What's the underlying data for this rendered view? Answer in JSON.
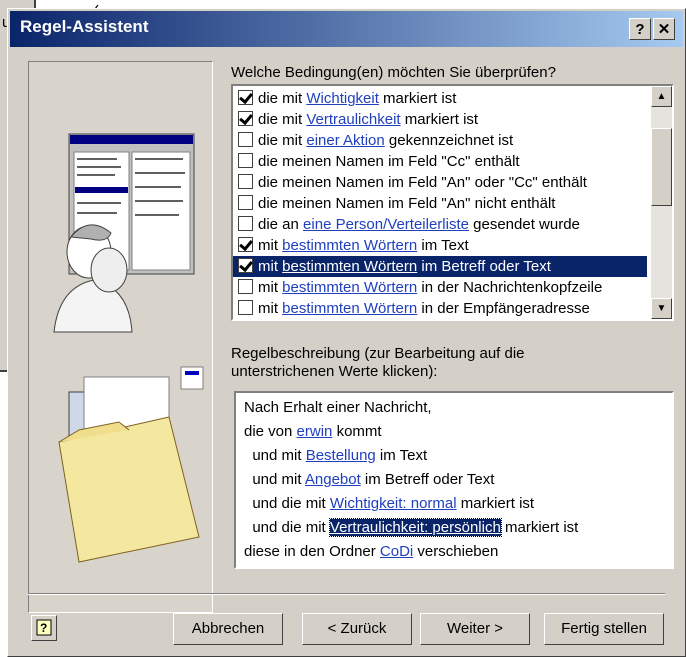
{
  "background_window": {
    "label": "u"
  },
  "dialog": {
    "title": "Regel-Assistent",
    "help_button": "?",
    "close_button": "✕"
  },
  "conditions": {
    "heading": "Welche Bedingung(en) möchten Sie überprüfen?",
    "items": [
      {
        "checked": true,
        "selected": false,
        "before": "die mit ",
        "link": "Wichtigkeit",
        "after": " markiert ist"
      },
      {
        "checked": true,
        "selected": false,
        "before": "die mit ",
        "link": "Vertraulichkeit",
        "after": " markiert ist"
      },
      {
        "checked": false,
        "selected": false,
        "before": "die mit ",
        "link": "einer Aktion",
        "after": " gekennzeichnet ist"
      },
      {
        "checked": false,
        "selected": false,
        "before": "die meinen Namen im Feld \"Cc\" enthält",
        "link": "",
        "after": ""
      },
      {
        "checked": false,
        "selected": false,
        "before": "die meinen Namen im Feld \"An\" oder \"Cc\" enthält",
        "link": "",
        "after": ""
      },
      {
        "checked": false,
        "selected": false,
        "before": "die meinen Namen im Feld \"An\" nicht enthält",
        "link": "",
        "after": ""
      },
      {
        "checked": false,
        "selected": false,
        "before": "die an ",
        "link": "eine Person/Verteilerliste",
        "after": " gesendet wurde"
      },
      {
        "checked": true,
        "selected": false,
        "before": "mit ",
        "link": "bestimmten Wörtern",
        "after": " im Text"
      },
      {
        "checked": true,
        "selected": true,
        "before": "mit ",
        "link": "bestimmten Wörtern",
        "after": " im Betreff oder Text"
      },
      {
        "checked": false,
        "selected": false,
        "before": "mit ",
        "link": "bestimmten Wörtern",
        "after": " in der Nachrichtenkopfzeile"
      },
      {
        "checked": false,
        "selected": false,
        "before": "mit ",
        "link": "bestimmten Wörtern",
        "after": " in der Empfängeradresse"
      }
    ]
  },
  "description": {
    "heading_line1": "Regelbeschreibung (zur Bearbeitung auf die",
    "heading_line2": "unterstrichenen Werte klicken):",
    "lines": [
      {
        "before": "Nach Erhalt einer Nachricht,",
        "link": "",
        "after": "",
        "highlight": false
      },
      {
        "before": "die von ",
        "link": "erwin",
        "after": " kommt",
        "highlight": false
      },
      {
        "before": "  und mit ",
        "link": "Bestellung",
        "after": " im Text",
        "highlight": false
      },
      {
        "before": "  und mit ",
        "link": "Angebot",
        "after": " im Betreff oder Text",
        "highlight": false
      },
      {
        "before": "  und die mit ",
        "link": "Wichtigkeit: normal",
        "after": " markiert ist",
        "highlight": false
      },
      {
        "before": "  und die mit ",
        "link": "Vertraulichkeit: persönlich",
        "after": " markiert ist",
        "highlight": true
      },
      {
        "before": "diese in den Ordner ",
        "link": "CoDi",
        "after": " verschieben",
        "highlight": false
      }
    ]
  },
  "buttons": {
    "cancel": "Abbrechen",
    "back": "< Zurück",
    "next": "Weiter >",
    "finish": "Fertig stellen"
  },
  "colors": {
    "title_start": "#0a246a",
    "title_end": "#a6caf0",
    "selection": "#0a246a",
    "link": "#1f3fbf",
    "face": "#d4d0c8"
  }
}
